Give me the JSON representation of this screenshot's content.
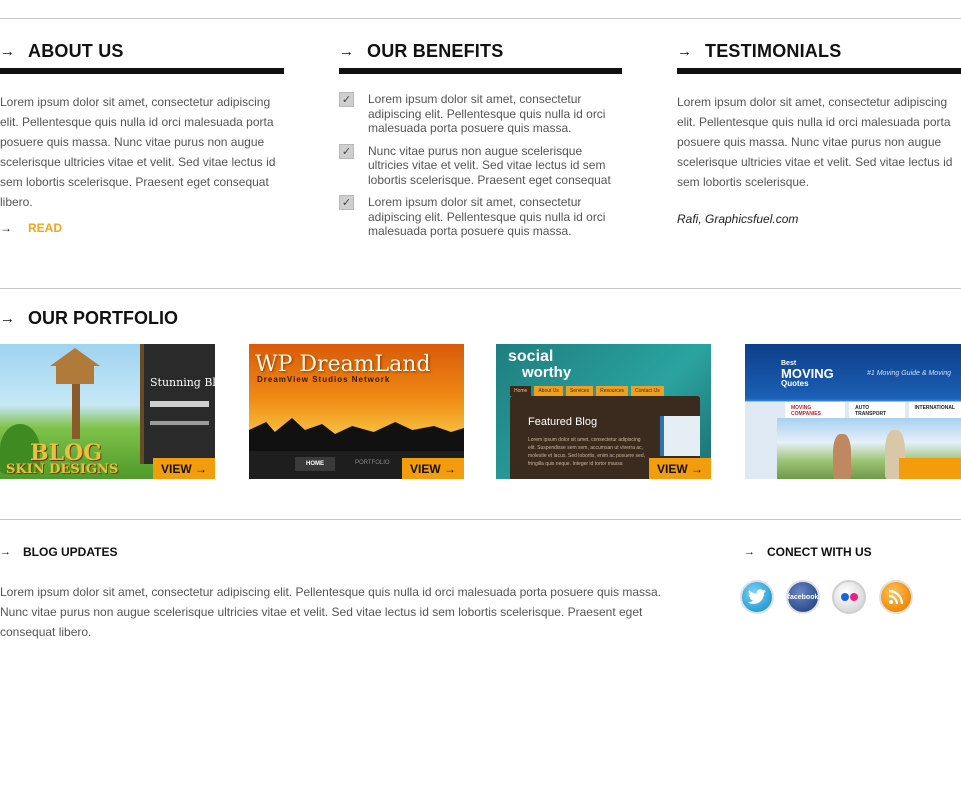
{
  "about": {
    "title": "ABOUT US",
    "body": "Lorem ipsum dolor sit amet, consectetur adipiscing elit. Pellentesque quis nulla id orci malesuada porta posuere quis massa. Nunc vitae purus non augue scelerisque ultricies vitae et velit. Sed vitae lectus id sem lobortis scelerisque. Praesent eget consequat libero.",
    "read_label": "READ"
  },
  "benefits": {
    "title": "OUR BENEFITS",
    "items": [
      "Lorem ipsum dolor sit amet, consectetur adipiscing elit. Pellentesque quis nulla id orci malesuada porta posuere quis massa.",
      "Nunc vitae purus non augue scelerisque ultricies vitae et velit. Sed vitae lectus id sem lobortis scelerisque. Praesent eget consequat",
      "Lorem ipsum dolor sit amet, consectetur adipiscing elit. Pellentesque quis nulla id orci malesuada porta posuere quis massa."
    ]
  },
  "testimonials": {
    "title": "TESTIMONIALS",
    "body": "Lorem ipsum dolor sit amet, consectetur adipiscing elit. Pellentesque quis nulla id orci malesuada porta posuere quis massa. Nunc vitae purus non augue scelerisque ultricies vitae et velit. Sed vitae lectus id sem lobortis scelerisque.",
    "author": "Rafi, Graphicsfuel.com"
  },
  "portfolio": {
    "title": "OUR PORTFOLIO",
    "view_label": "VIEW",
    "items": [
      {
        "name": "blog-skin-designs",
        "line1": "BLOG",
        "line2": "SKIN DESIGNS",
        "extra": "Stunning Blog S"
      },
      {
        "name": "wp-dreamland",
        "line1": "WP DreamLand",
        "line2": "DreamView Studios Network",
        "nav1": "HOME",
        "nav2": "PORTFOLIO"
      },
      {
        "name": "social-worthy",
        "line1": "social",
        "line2": "worthy",
        "tabs": [
          "Home",
          "About Us",
          "Services",
          "Resources",
          "Contact Us"
        ],
        "feature": "Featured Blog",
        "feature_body": "Lorem ipsum dolor sit amet, consectetur adipiscing elit. Suspendisse sem sem, accumsan ut viverra ac, molestie et lacus. Sed lobortis, enim ac posuere sed, fringilla quis neque. Integer id tortor massa"
      },
      {
        "name": "best-moving-quotes",
        "line1": "Best",
        "line2": "MOVING",
        "line3": "Quotes",
        "tagline": "#1 Moving Guide & Moving",
        "nav": [
          "MOVING COMPANIES",
          "AUTO TRANSPORT",
          "INTERNATIONAL"
        ]
      }
    ]
  },
  "blog": {
    "title": "BLOG UPDATES",
    "body": "Lorem ipsum dolor sit amet, consectetur adipiscing elit. Pellentesque quis nulla id orci malesuada porta posuere quis massa. Nunc vitae purus non augue scelerisque ultricies vitae et velit. Sed vitae lectus id sem lobortis scelerisque. Praesent eget consequat libero."
  },
  "connect": {
    "title": "CONECT WITH US",
    "facebook_label": "facebook"
  },
  "colors": {
    "accent": "#f59c0c",
    "read_link": "#f5a317",
    "heading": "#111111"
  }
}
